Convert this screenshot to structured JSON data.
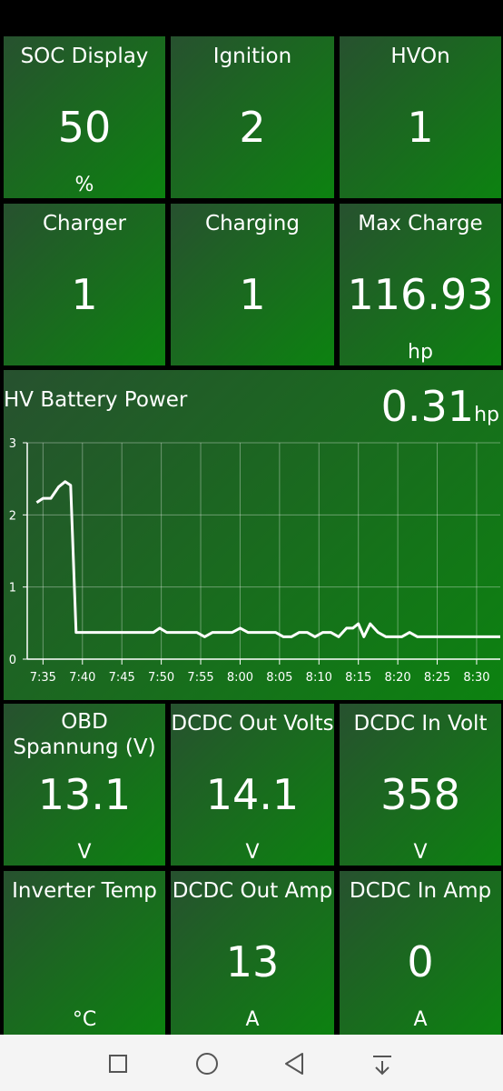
{
  "tiles_row1": [
    {
      "title": "SOC Display",
      "value": "50",
      "unit": "%"
    },
    {
      "title": "Ignition",
      "value": "2",
      "unit": ""
    },
    {
      "title": "HVOn",
      "value": "1",
      "unit": ""
    }
  ],
  "tiles_row2": [
    {
      "title": "Charger",
      "value": "1",
      "unit": ""
    },
    {
      "title": "Charging",
      "value": "1",
      "unit": ""
    },
    {
      "title": "Max Charge",
      "value": "116.93",
      "unit": "hp"
    }
  ],
  "tiles_row3": [
    {
      "title": "OBD Spannung (V)",
      "value": "13.1",
      "unit": "V"
    },
    {
      "title": "DCDC Out Volts",
      "value": "14.1",
      "unit": "V"
    },
    {
      "title": "DCDC In Volt",
      "value": "358",
      "unit": "V"
    }
  ],
  "tiles_row4": [
    {
      "title": "Inverter Temp",
      "value": "",
      "unit": "°C"
    },
    {
      "title": "DCDC Out Amp",
      "value": "13",
      "unit": "A"
    },
    {
      "title": "DCDC In Amp",
      "value": "0",
      "unit": "A"
    }
  ],
  "battery": {
    "title": "HV Battery Power",
    "value": "0.31",
    "unit": "hp"
  },
  "chart_data": {
    "type": "line",
    "ylim": [
      0,
      3
    ],
    "yticks": [
      "0",
      "1",
      "2",
      "3"
    ],
    "xlim_minutes": [
      453,
      513
    ],
    "xticks": [
      {
        "m": 455,
        "label": "7:35"
      },
      {
        "m": 460,
        "label": "7:40"
      },
      {
        "m": 465,
        "label": "7:45"
      },
      {
        "m": 470,
        "label": "7:50"
      },
      {
        "m": 475,
        "label": "7:55"
      },
      {
        "m": 480,
        "label": "8:00"
      },
      {
        "m": 485,
        "label": "8:05"
      },
      {
        "m": 490,
        "label": "8:10"
      },
      {
        "m": 495,
        "label": "8:15"
      },
      {
        "m": 500,
        "label": "8:20"
      },
      {
        "m": 505,
        "label": "8:25"
      },
      {
        "m": 510,
        "label": "8:30"
      }
    ],
    "grid": true,
    "series": [
      {
        "color": "#ffffff",
        "x": [
          454.2,
          455.0,
          456.0,
          457.0,
          457.8,
          458.5,
          459.2,
          459.8,
          460.5,
          469.0,
          469.8,
          470.7,
          474.5,
          475.5,
          476.5,
          479.0,
          480.0,
          481.0,
          484.5,
          485.5,
          486.5,
          487.5,
          488.5,
          489.5,
          490.5,
          491.5,
          492.5,
          493.5,
          494.3,
          495.0,
          495.7,
          496.5,
          497.5,
          498.5,
          499.5,
          500.5,
          501.5,
          502.5,
          513.0
        ],
        "y": [
          2.17,
          2.23,
          2.23,
          2.39,
          2.46,
          2.41,
          0.37,
          0.37,
          0.37,
          0.37,
          0.43,
          0.37,
          0.37,
          0.31,
          0.37,
          0.37,
          0.43,
          0.37,
          0.37,
          0.31,
          0.31,
          0.37,
          0.37,
          0.31,
          0.37,
          0.37,
          0.31,
          0.43,
          0.43,
          0.49,
          0.31,
          0.49,
          0.37,
          0.31,
          0.31,
          0.31,
          0.37,
          0.31,
          0.31
        ]
      }
    ]
  },
  "nav": [
    {
      "name": "recent-apps-icon"
    },
    {
      "name": "home-icon"
    },
    {
      "name": "back-icon"
    },
    {
      "name": "notification-pull-icon"
    }
  ]
}
